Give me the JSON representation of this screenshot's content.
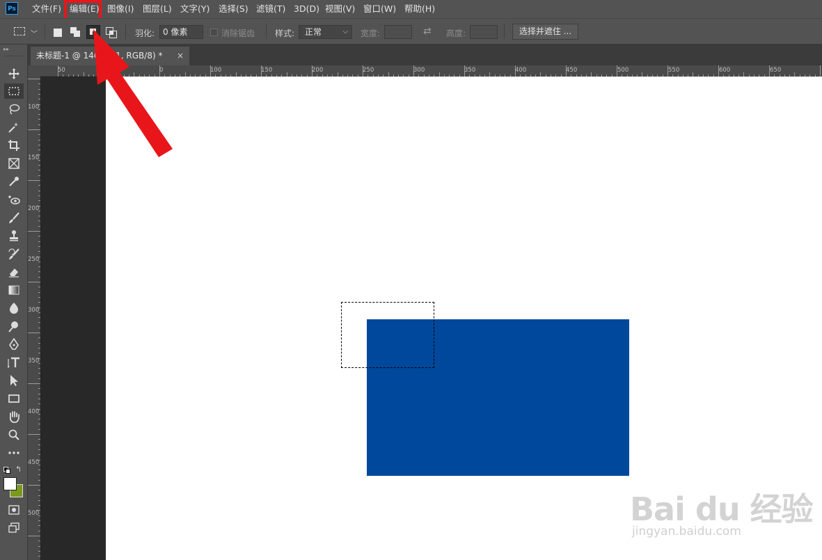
{
  "app": {
    "logo": "Ps"
  },
  "menu": [
    {
      "label": "文件(F)"
    },
    {
      "label": "编辑(E)"
    },
    {
      "label": "图像(I)"
    },
    {
      "label": "图层(L)"
    },
    {
      "label": "文字(Y)"
    },
    {
      "label": "选择(S)"
    },
    {
      "label": "滤镜(T)"
    },
    {
      "label": "3D(D)"
    },
    {
      "label": "视图(V)"
    },
    {
      "label": "窗口(W)"
    },
    {
      "label": "帮助(H)"
    }
  ],
  "highlighted_menu": "编辑(E)",
  "options": {
    "feather_label": "羽化:",
    "feather_value": "0 像素",
    "antialias_label": "消除锯齿",
    "style_label": "样式:",
    "style_value": "正常",
    "width_label": "宽度:",
    "height_label": "高度:",
    "select_mask_button": "选择并遮住 ..."
  },
  "document": {
    "tab_title": "未标题-1 @ 146",
    "tab_title_suffix": "形 1, RGB/8) *",
    "close_glyph": "×"
  },
  "ruler": {
    "h_labels": [
      "50",
      "0",
      "50",
      "100",
      "150",
      "200",
      "250",
      "300",
      "350",
      "400",
      "450",
      "500",
      "550",
      "600",
      "650"
    ],
    "v_labels": [
      "100",
      "150",
      "200",
      "250",
      "300",
      "350",
      "400",
      "450",
      "500"
    ]
  },
  "canvas": {
    "background": "#ffffff",
    "shape_color": "#00489b",
    "pasteboard_color": "#282828"
  },
  "annotation": {
    "arrow_color": "#e8161a",
    "box_color": "#e8161a"
  },
  "watermark": {
    "text": "Bai du 经验",
    "url": "jingyan.baidu.com"
  }
}
